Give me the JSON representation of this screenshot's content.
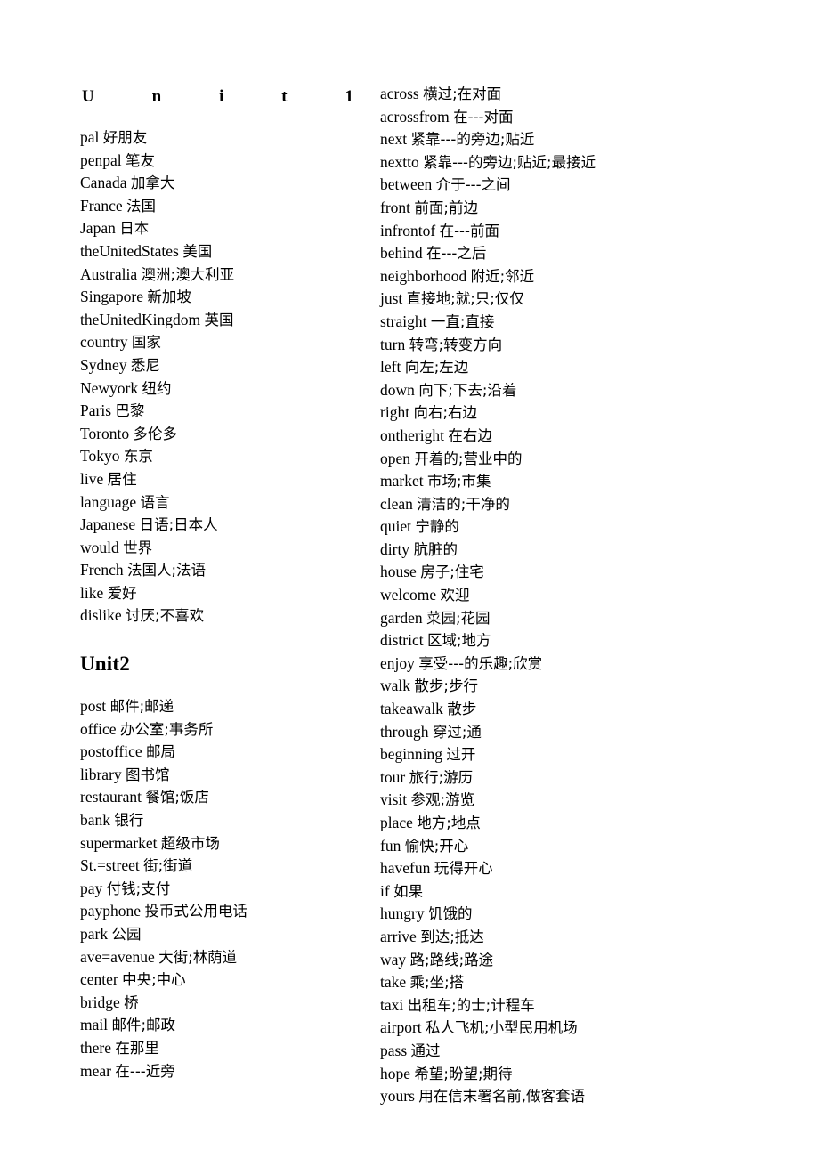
{
  "document": {
    "page_background": "#ffffff",
    "text_color": "#000000"
  },
  "left_column": {
    "unit1_title_letters": [
      "U",
      "n",
      "i",
      "t",
      "1"
    ],
    "unit1_title_text": "Unit 1",
    "unit1_entries": [
      {
        "term": "pal",
        "gloss": "好朋友"
      },
      {
        "term": "penpal",
        "gloss": "笔友"
      },
      {
        "term": "Canada",
        "gloss": "加拿大"
      },
      {
        "term": "France",
        "gloss": "法国"
      },
      {
        "term": "Japan",
        "gloss": "日本"
      },
      {
        "term": "theUnitedStates",
        "gloss": "美国"
      },
      {
        "term": "Australia",
        "gloss": "澳洲;澳大利亚"
      },
      {
        "term": "Singapore",
        "gloss": "新加坡"
      },
      {
        "term": "theUnitedKingdom",
        "gloss": "英国"
      },
      {
        "term": "country",
        "gloss": "国家"
      },
      {
        "term": "Sydney",
        "gloss": "悉尼"
      },
      {
        "term": "Newyork",
        "gloss": "纽约"
      },
      {
        "term": "Paris",
        "gloss": "巴黎"
      },
      {
        "term": "Toronto",
        "gloss": "多伦多"
      },
      {
        "term": "Tokyo",
        "gloss": "东京"
      },
      {
        "term": "live",
        "gloss": "居住"
      },
      {
        "term": "language",
        "gloss": "语言"
      },
      {
        "term": "Japanese",
        "gloss": "日语;日本人"
      },
      {
        "term": "would",
        "gloss": "世界"
      },
      {
        "term": "French",
        "gloss": "法国人;法语"
      },
      {
        "term": "like",
        "gloss": "爱好"
      },
      {
        "term": "dislike",
        "gloss": "讨厌;不喜欢"
      }
    ],
    "unit2_heading": "Unit2",
    "unit2_entries": [
      {
        "term": "post",
        "gloss": "邮件;邮递"
      },
      {
        "term": "office",
        "gloss": "办公室;事务所"
      },
      {
        "term": "postoffice",
        "gloss": "邮局"
      },
      {
        "term": "library",
        "gloss": "图书馆"
      },
      {
        "term": "restaurant",
        "gloss": "餐馆;饭店"
      },
      {
        "term": "bank",
        "gloss": "银行"
      },
      {
        "term": "supermarket",
        "gloss": "超级市场"
      },
      {
        "term": "St.=street",
        "gloss": "街;街道"
      },
      {
        "term": "pay",
        "gloss": "付钱;支付"
      },
      {
        "term": "payphone",
        "gloss": "投币式公用电话"
      },
      {
        "term": "park",
        "gloss": "公园"
      },
      {
        "term": "ave=avenue",
        "gloss": "大街;林荫道"
      },
      {
        "term": "center",
        "gloss": "中央;中心"
      },
      {
        "term": "bridge",
        "gloss": "桥"
      },
      {
        "term": "mail",
        "gloss": "邮件;邮政"
      },
      {
        "term": "there",
        "gloss": "在那里"
      },
      {
        "term": "mear",
        "gloss": "在---近旁"
      }
    ]
  },
  "right_column": {
    "entries": [
      {
        "term": "across",
        "gloss": "横过;在对面"
      },
      {
        "term": "acrossfrom",
        "gloss": "在---对面"
      },
      {
        "term": "next",
        "gloss": "紧靠---的旁边;贴近"
      },
      {
        "term": "nextto",
        "gloss": "紧靠---的旁边;贴近;最接近"
      },
      {
        "term": "between",
        "gloss": "介于---之间"
      },
      {
        "term": "front",
        "gloss": "前面;前边"
      },
      {
        "term": "infrontof",
        "gloss": "在---前面"
      },
      {
        "term": "behind",
        "gloss": "在---之后"
      },
      {
        "term": "neighborhood",
        "gloss": "附近;邻近"
      },
      {
        "term": "just",
        "gloss": "直接地;就;只;仅仅"
      },
      {
        "term": "straight",
        "gloss": "一直;直接"
      },
      {
        "term": "turn",
        "gloss": "转弯;转变方向"
      },
      {
        "term": "left",
        "gloss": "向左;左边"
      },
      {
        "term": "down",
        "gloss": "向下;下去;沿着"
      },
      {
        "term": "right",
        "gloss": "向右;右边"
      },
      {
        "term": "ontheright",
        "gloss": "在右边"
      },
      {
        "term": "open",
        "gloss": "开着的;营业中的"
      },
      {
        "term": "market",
        "gloss": "市场;市集"
      },
      {
        "term": "clean",
        "gloss": "清洁的;干净的"
      },
      {
        "term": "quiet",
        "gloss": "宁静的"
      },
      {
        "term": "dirty",
        "gloss": "肮脏的"
      },
      {
        "term": "house",
        "gloss": "房子;住宅"
      },
      {
        "term": "welcome",
        "gloss": "欢迎"
      },
      {
        "term": "garden",
        "gloss": "菜园;花园"
      },
      {
        "term": "district",
        "gloss": "区域;地方"
      },
      {
        "term": "enjoy",
        "gloss": "享受---的乐趣;欣赏"
      },
      {
        "term": "walk",
        "gloss": "散步;步行"
      },
      {
        "term": "takeawalk",
        "gloss": "散步"
      },
      {
        "term": "through",
        "gloss": "穿过;通"
      },
      {
        "term": "beginning",
        "gloss": "过开"
      },
      {
        "term": "tour",
        "gloss": "旅行;游历"
      },
      {
        "term": "visit",
        "gloss": "参观;游览"
      },
      {
        "term": "place",
        "gloss": "地方;地点"
      },
      {
        "term": "fun",
        "gloss": "愉快;开心"
      },
      {
        "term": "havefun",
        "gloss": "玩得开心"
      },
      {
        "term": "if",
        "gloss": "如果"
      },
      {
        "term": "hungry",
        "gloss": "饥饿的"
      },
      {
        "term": "arrive",
        "gloss": "到达;抵达"
      },
      {
        "term": "way",
        "gloss": "路;路线;路途"
      },
      {
        "term": "take",
        "gloss": "乘;坐;搭"
      },
      {
        "term": "taxi",
        "gloss": "出租车;的士;计程车"
      },
      {
        "term": "airport",
        "gloss": "私人飞机;小型民用机场"
      },
      {
        "term": "pass",
        "gloss": "通过"
      },
      {
        "term": "hope",
        "gloss": "希望;盼望;期待"
      },
      {
        "term": "yours",
        "gloss": "用在信末署名前,做客套语"
      }
    ]
  }
}
